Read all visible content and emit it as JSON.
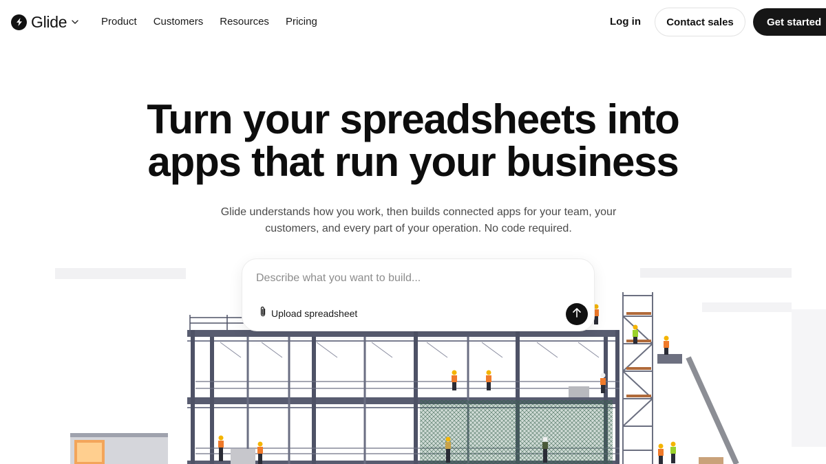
{
  "brand": {
    "name": "Glide"
  },
  "nav": {
    "links": [
      "Product",
      "Customers",
      "Resources",
      "Pricing"
    ],
    "login": "Log in",
    "contact_sales": "Contact sales",
    "get_started": "Get started"
  },
  "hero": {
    "headline_line1": "Turn your spreadsheets into",
    "headline_line2": "apps that run your business",
    "subheadline": "Glide understands how you work, then builds connected apps for your team, your customers, and every part of your operation. No code required."
  },
  "prompt": {
    "placeholder": "Describe what you want to build...",
    "upload_label": "Upload spreadsheet"
  },
  "icons": {
    "logo": "bolt-logo-icon",
    "brand_menu": "chevron-down-icon",
    "upload": "paperclip-icon",
    "send": "arrow-up-icon"
  },
  "colors": {
    "primary_button": "#161616",
    "text": "#111111",
    "subtext": "#4a4a4a",
    "safety_vest": "#f07a2a",
    "steel": "#4e5266",
    "net": "#3f6b56"
  }
}
